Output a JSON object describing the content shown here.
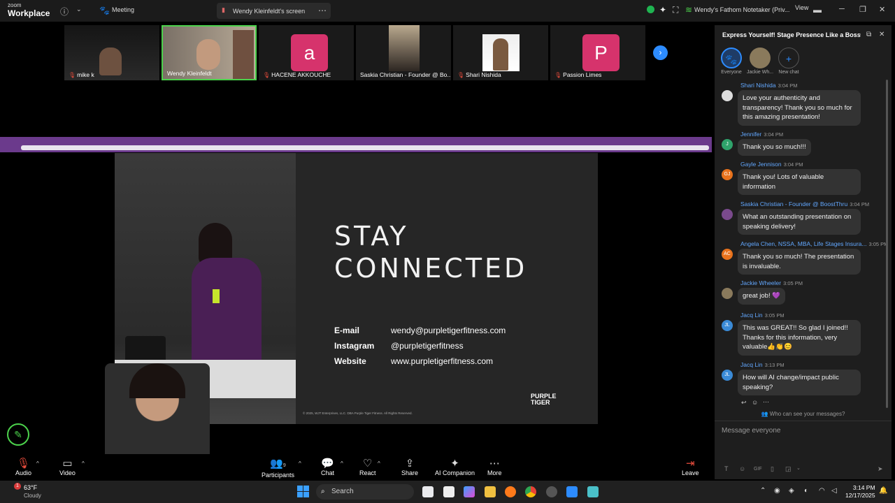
{
  "app": {
    "logo_small": "zoom",
    "logo_main": "Workplace",
    "meeting_label": "Meeting",
    "screen_tab_label": "Wendy Kleinfeldt's screen",
    "notetaker_label": "Wendy's Fathom Notetaker (Priv...",
    "view_label": "View"
  },
  "participants_strip": [
    {
      "name": "mike k",
      "type": "video"
    },
    {
      "name": "Wendy Kleinfeldt",
      "type": "video"
    },
    {
      "name": "HACENE AKKOUCHE",
      "type": "avatar",
      "initial": "a",
      "color": "#d6336c"
    },
    {
      "name": "Saskia Christian - Founder @ Bo...",
      "type": "video"
    },
    {
      "name": "Shari Nishida",
      "type": "video"
    },
    {
      "name": "Passion Limes",
      "type": "avatar",
      "initial": "P",
      "color": "#d6336c"
    }
  ],
  "slide": {
    "title_line1": "STAY",
    "title_line2": "CONNECTED",
    "rows": [
      {
        "label": "E-mail",
        "value": "wendy@purpletigerfitness.com"
      },
      {
        "label": "Instagram",
        "value": "@purpletigerfitness"
      },
      {
        "label": "Website",
        "value": "www.purpletigerfitness.com"
      }
    ],
    "copyright": "© 2025, WJT Enterprises, LLC. DBA Purple Tiger Fitness. All Rights Reserved.",
    "brand_line1": "PURPLE",
    "brand_line2": "TIGER"
  },
  "toolbar": {
    "audio": "Audio",
    "video": "Video",
    "participants": "Participants",
    "participants_count": "9",
    "chat": "Chat",
    "react": "React",
    "share": "Share",
    "ai_companion": "AI Companion",
    "more": "More",
    "leave": "Leave"
  },
  "chat": {
    "title": "Express Yourself! Stage Presence Like a Boss",
    "channels": [
      "Everyone",
      "Jackie Wh...",
      "New chat"
    ],
    "messages": [
      {
        "sender": "Shari Nishida",
        "time": "3:04 PM",
        "text": "Love your authenticity and transparency!  Thank you so much for this amazing presentation!",
        "avatar": "",
        "avatar_color": "#ddd"
      },
      {
        "sender": "Jennifer",
        "time": "3:04 PM",
        "text": "Thank you so much!!!",
        "avatar": "J",
        "avatar_color": "#2fa36b"
      },
      {
        "sender": "Gayle Jennison",
        "time": "3:04 PM",
        "text": "Thank you! Lots of valuable information",
        "avatar": "GJ",
        "avatar_color": "#e8721c"
      },
      {
        "sender": "Saskia Christian - Founder @ BoostThru",
        "time": "3:04 PM",
        "text": "What an outstanding presentation on speaking delivery!",
        "avatar": "",
        "avatar_color": "#7a4a8c"
      },
      {
        "sender": "Angela Chen, NSSA, MBA, Life Stages Insura...",
        "time": "3:05 PM",
        "text": "Thank you so much! The presentation is invaluable.",
        "avatar": "AC",
        "avatar_color": "#e8721c"
      },
      {
        "sender": "Jackie Wheeler",
        "time": "3:05 PM",
        "text": "great job! 💜",
        "avatar": "",
        "avatar_color": "#8a7a5c"
      },
      {
        "sender": "Jacq Lin",
        "time": "3:05 PM",
        "text": "This was GREAT!! So glad I joined!! Thanks for this information, very valuable👍👏😊",
        "avatar": "JL",
        "avatar_color": "#3a8ad6"
      },
      {
        "sender": "Jacq Lin",
        "time": "3:13 PM",
        "text": "How will AI change/impact public speaking?",
        "avatar": "JL",
        "avatar_color": "#3a8ad6"
      }
    ],
    "who_can_see": "Who can see your messages?",
    "input_placeholder": "Message everyone"
  },
  "taskbar": {
    "temp": "63°F",
    "condition": "Cloudy",
    "weather_badge": "1",
    "search_label": "Search",
    "time": "3:14 PM",
    "date": "12/17/2025"
  }
}
